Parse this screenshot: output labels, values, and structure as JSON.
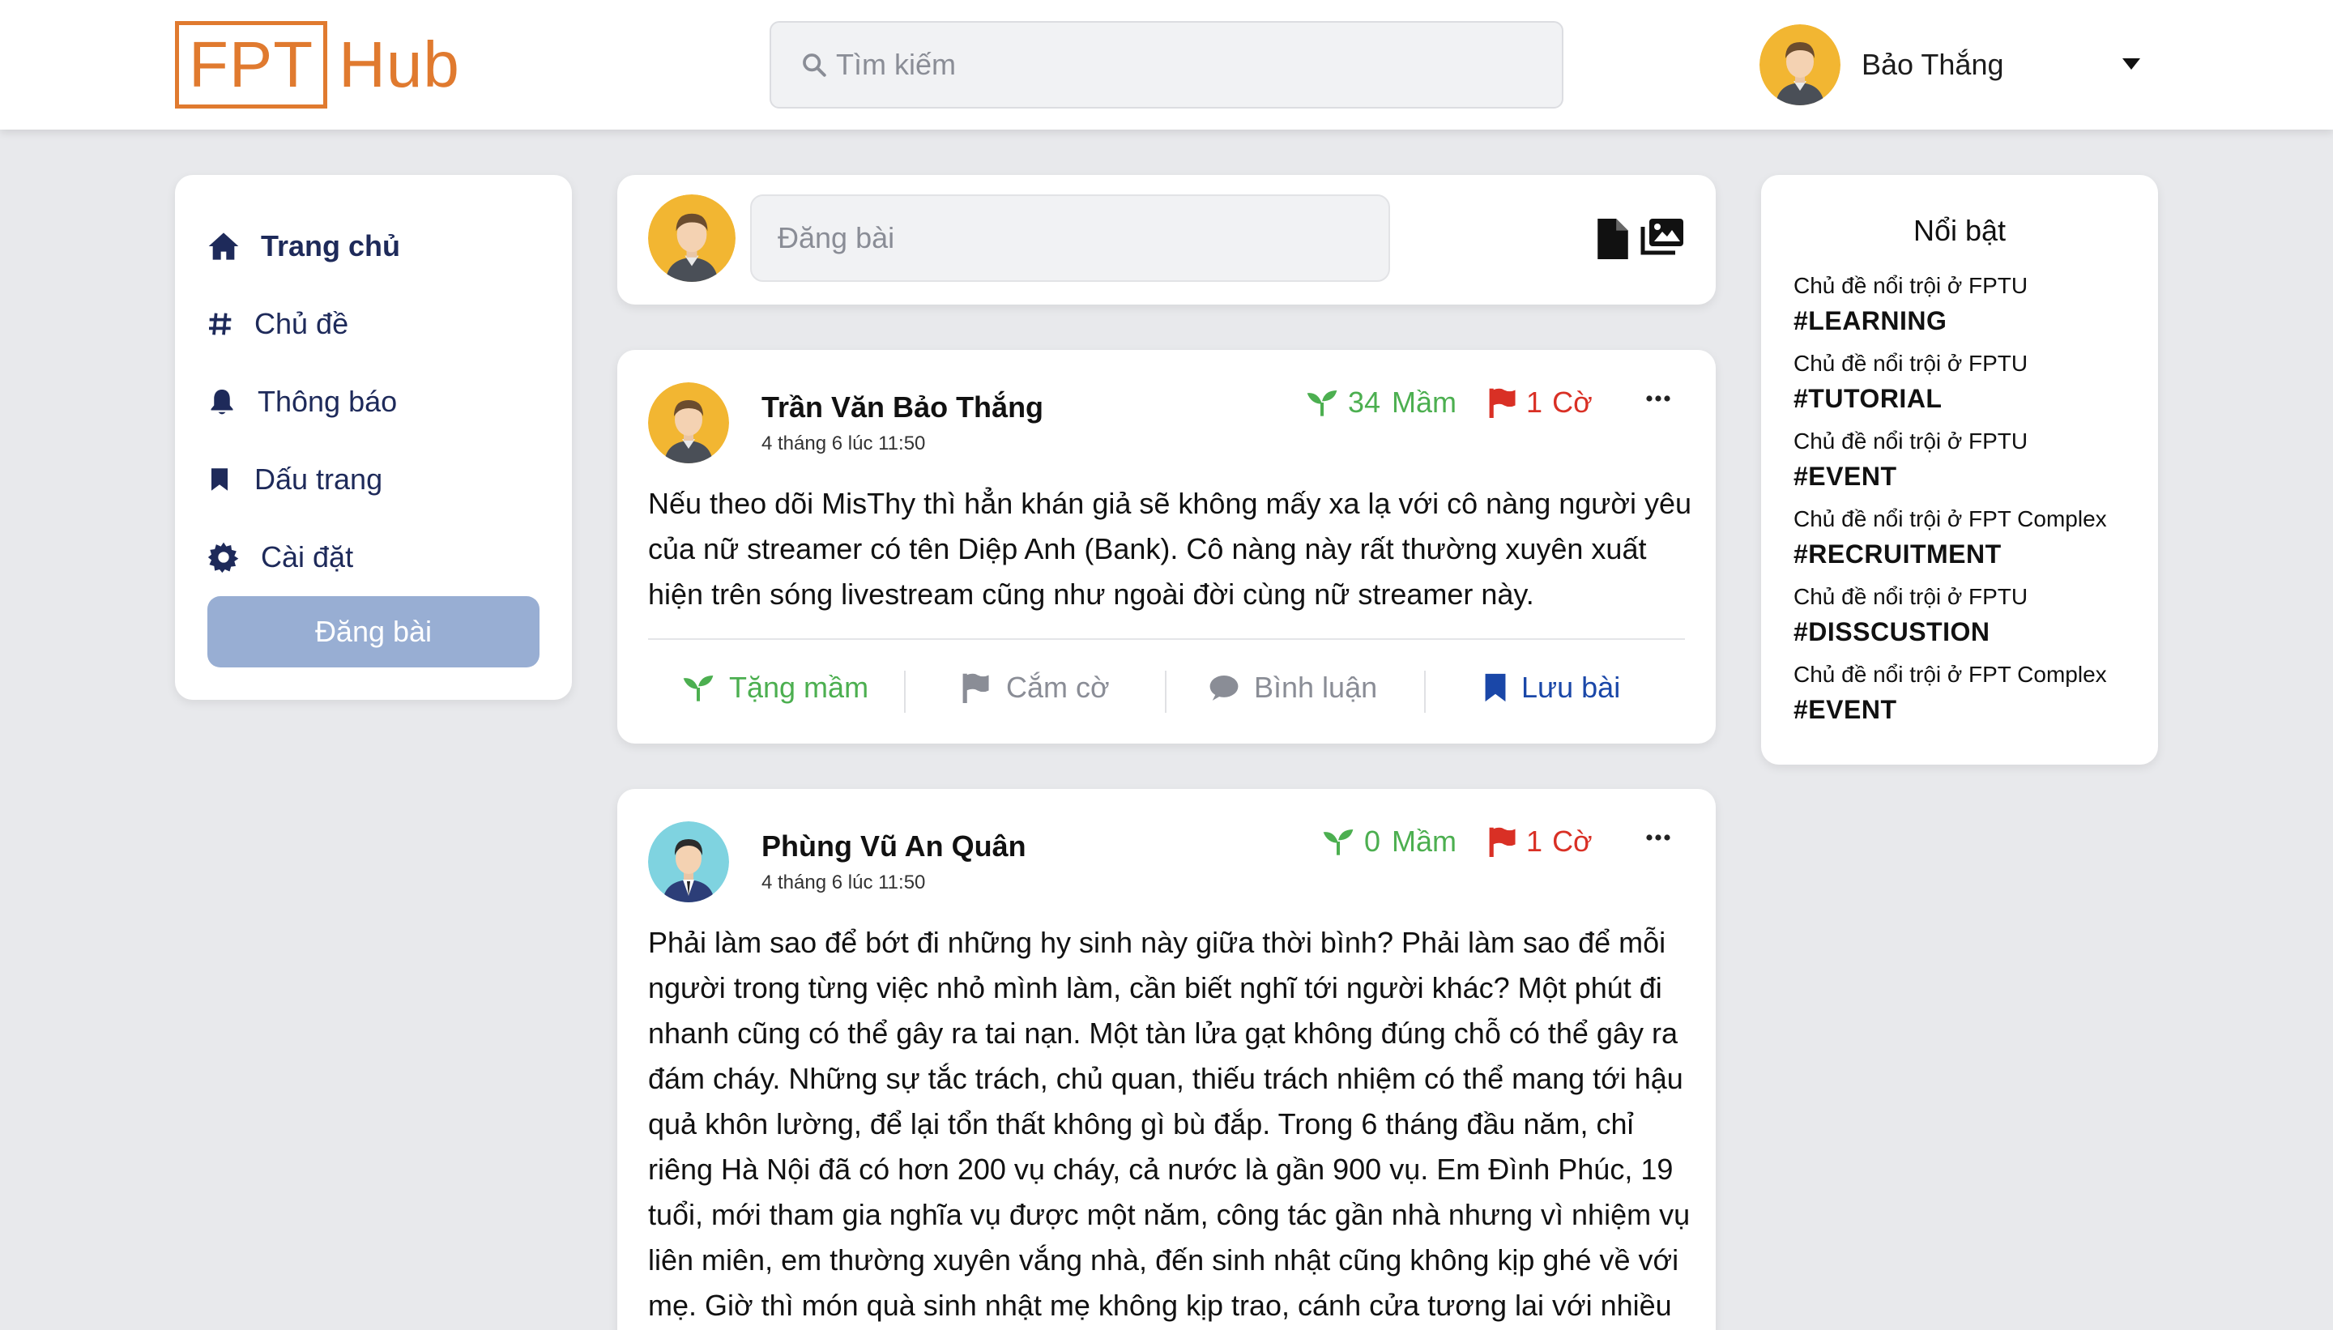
{
  "header": {
    "logo_box": "FPT",
    "logo_rest": "Hub",
    "search_placeholder": "Tìm kiếm",
    "user_name": "Bảo Thắng"
  },
  "sidebar": {
    "items": [
      {
        "label": "Trang chủ",
        "icon": "home-icon",
        "active": true
      },
      {
        "label": "Chủ đề",
        "icon": "hashtag-icon"
      },
      {
        "label": "Thông báo",
        "icon": "bell-icon"
      },
      {
        "label": "Dấu trang",
        "icon": "bookmark-icon"
      },
      {
        "label": "Cài đặt",
        "icon": "gear-icon"
      }
    ],
    "post_button": "Đăng bài"
  },
  "composer": {
    "placeholder": "Đăng bài"
  },
  "posts": [
    {
      "author": "Trần Văn Bảo Thắng",
      "time": "4 tháng 6 lúc 11:50",
      "mam": "34",
      "mam_label": "Mầm",
      "co": "1",
      "co_label": "Cờ",
      "body": "Nếu theo dõi MisThy thì hẳn khán giả sẽ không mấy xa lạ với cô nàng người yêu của nữ streamer có tên Diệp Anh (Bank). Cô nàng này rất thường xuyên xuất hiện trên sóng livestream cũng như ngoài đời cùng nữ streamer này."
    },
    {
      "author": "Phùng Vũ An Quân",
      "time": "4 tháng 6 lúc 11:50",
      "mam": "0",
      "mam_label": "Mầm",
      "co": "1",
      "co_label": "Cờ",
      "body": "Phải làm sao để bớt đi những hy sinh này giữa thời bình? Phải làm sao để mỗi người trong từng việc nhỏ mình làm, cần biết nghĩ tới người khác? Một phút đi nhanh cũng có thể gây ra tai nạn. Một tàn lửa gạt không đúng chỗ có thể gây ra đám cháy. Những sự tắc trách, chủ quan, thiếu trách nhiệm có thể mang tới hậu quả khôn lường, để lại tổn thất không gì bù đắp. Trong 6 tháng đầu năm, chỉ riêng Hà Nội đã có hơn 200 vụ cháy, cả nước là gần 900 vụ. Em Đình Phúc, 19 tuổi, mới tham gia nghĩa vụ được một năm, công tác gần nhà nhưng vì nhiệm vụ liên miên, em thường xuyên vắng nhà, đến sinh nhật cũng không kịp ghé về với mẹ. Giờ thì món quà sinh nhật mẹ không kịp trao, cánh cửa tương lai với nhiều"
    }
  ],
  "actions": {
    "tang_mam": "Tặng mầm",
    "cam_co": "Cắm cờ",
    "binh_luan": "Bình luận",
    "luu_bai": "Lưu bài"
  },
  "trending": {
    "title": "Nổi bật",
    "items": [
      {
        "sub": "Chủ đề nổi trội ở FPTU",
        "tag": "#LEARNING"
      },
      {
        "sub": "Chủ đề nổi trội ở FPTU",
        "tag": "#TUTORIAL"
      },
      {
        "sub": "Chủ đề nổi trội ở FPTU",
        "tag": "#EVENT"
      },
      {
        "sub": "Chủ đề nổi trội ở FPT Complex",
        "tag": "#RECRUITMENT"
      },
      {
        "sub": "Chủ đề nổi trội ở FPTU",
        "tag": "#DISSCUSTION"
      },
      {
        "sub": "Chủ đề nổi trội ở FPT Complex",
        "tag": "#EVENT"
      }
    ]
  },
  "colors": {
    "brand": "#e07a2f",
    "nav_text": "#1e2a5a",
    "primary_button": "#98aed3",
    "sprout_green": "#4caf50",
    "flag_red": "#d93025",
    "bookmark_blue": "#1a47a8"
  }
}
